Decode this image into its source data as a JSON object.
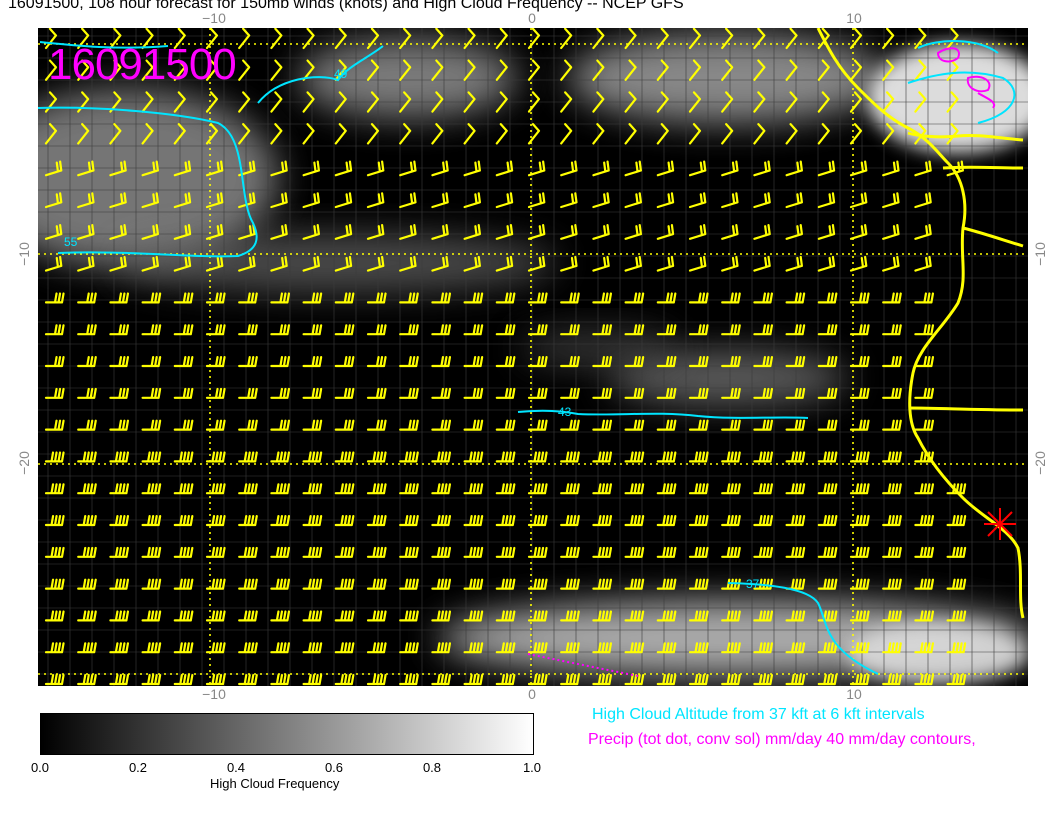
{
  "title": "16091500, 108 hour forecast for 150mb winds (knots) and High Cloud Frequency -- NCEP GFS",
  "frame_label": "16091500",
  "axes": {
    "top_ticks": [
      "−10",
      "0",
      "10"
    ],
    "bottom_ticks": [
      "−10",
      "0",
      "10"
    ],
    "left_ticks": [
      "−10",
      "−20"
    ],
    "right_ticks": [
      "−10",
      "−20"
    ]
  },
  "contour_labels": [
    "49",
    "55",
    "43",
    "37"
  ],
  "colorbar": {
    "title": "High Cloud Frequency",
    "ticks": [
      "0.0",
      "0.2",
      "0.4",
      "0.6",
      "0.8",
      "1.0"
    ],
    "colors": [
      "#000000",
      "#ffffff"
    ]
  },
  "legend": {
    "cyan": "High Cloud Altitude from 37 kft at 6 kft intervals",
    "magenta": "Precip (tot dot, conv sol) mm/day 40 mm/day contours,"
  },
  "colors": {
    "barbs": "#ffff00",
    "coast": "#ffff00",
    "contour": "#00e5ff",
    "precip": "#ff00ff",
    "marker": "#ff0000"
  }
}
